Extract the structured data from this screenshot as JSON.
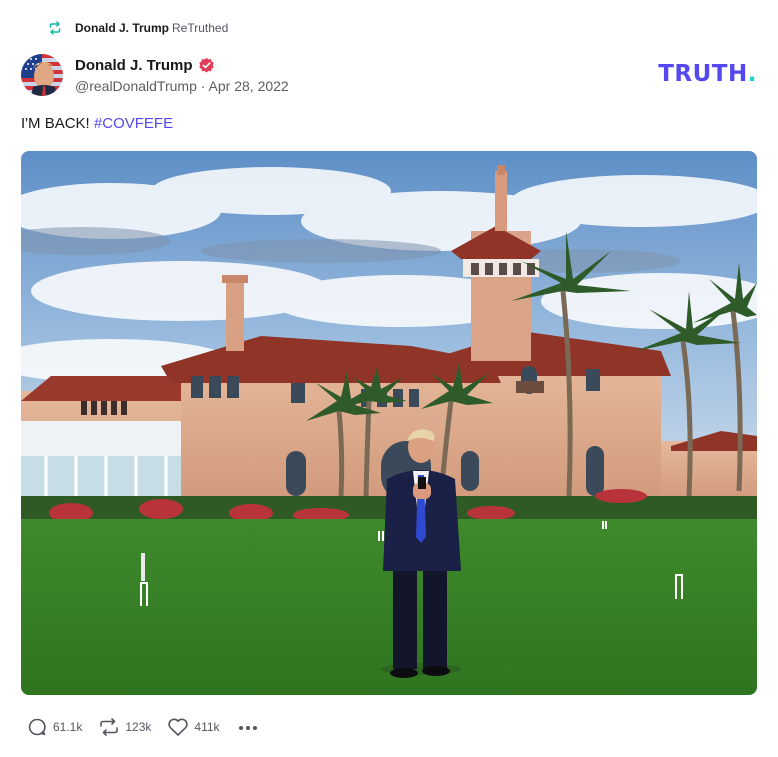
{
  "retruth": {
    "icon": "retruth-icon",
    "author": "Donald J. Trump",
    "label": "ReTruthed"
  },
  "post": {
    "display_name": "Donald J. Trump",
    "verified_icon": "verified-badge-icon",
    "handle": "@realDonaldTrump",
    "separator": "·",
    "date": "Apr 28, 2022",
    "text_plain": "I'M BACK! ",
    "hashtag": "#COVFEFE"
  },
  "brand": {
    "logo_text": "TRUTH",
    "logo_dot": ".",
    "color_primary": "#5448EE",
    "color_accent": "#17D4C6"
  },
  "actions": {
    "reply_count": "61.1k",
    "retruth_count": "123k",
    "like_count": "411k",
    "reply_icon": "reply-icon",
    "retruth_icon": "retruth-icon",
    "like_icon": "heart-icon",
    "more_icon": "more-icon"
  }
}
